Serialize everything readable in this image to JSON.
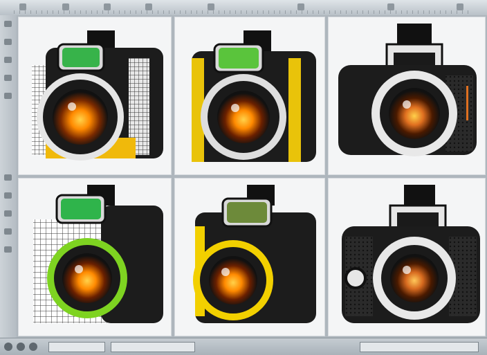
{
  "window": {
    "title": ""
  },
  "toolbar": {
    "tools": [
      "tool",
      "tool",
      "tool",
      "tool",
      "tool",
      "tool",
      "tool",
      "tool"
    ]
  },
  "toolbox": {
    "tools": [
      "tool",
      "tool",
      "tool",
      "tool",
      "tool",
      "tool",
      "tool",
      "tool",
      "tool",
      "tool"
    ]
  },
  "statusbar": {
    "buttons": [
      "circle-button",
      "circle-button",
      "circle-button"
    ]
  },
  "canvas": {
    "cameras": [
      {
        "id": "camera-1",
        "style": "mesh-left",
        "accent": "#f0b90b",
        "viewfinder": "#37b34a"
      },
      {
        "id": "camera-2",
        "style": "yellow-trim",
        "accent": "#e9c30a",
        "viewfinder": "#5ac43c"
      },
      {
        "id": "camera-3",
        "style": "twin-lens-reflex",
        "accent": "#e07020",
        "viewfinder": "#1a1a1a"
      },
      {
        "id": "camera-4",
        "style": "grid-green-lens",
        "accent": "#7ed321",
        "viewfinder": "#2fb44b"
      },
      {
        "id": "camera-5",
        "style": "yellow-ring",
        "accent": "#f2d000",
        "viewfinder": "#6d8a3a"
      },
      {
        "id": "camera-6",
        "style": "compact-mesh",
        "accent": "#d76a1f",
        "viewfinder": "#222222"
      }
    ]
  },
  "colors": {
    "body": "#1c1c1c",
    "trim": "#d9d9d9",
    "lens_glow": "#ff8a00",
    "background": "#f4f5f6"
  }
}
